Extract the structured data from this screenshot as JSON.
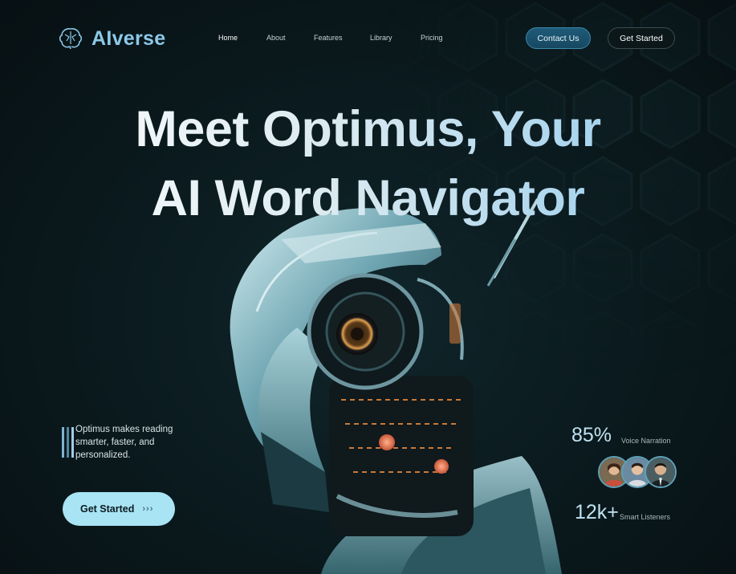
{
  "brand": {
    "name": "AIverse",
    "logo_icon": "brain-icon"
  },
  "nav": {
    "items": [
      {
        "label": "Home",
        "active": true
      },
      {
        "label": "About",
        "active": false
      },
      {
        "label": "Features",
        "active": false
      },
      {
        "label": "Library",
        "active": false
      },
      {
        "label": "Pricing",
        "active": false
      }
    ],
    "contact_label": "Contact Us",
    "get_started_label": "Get Started"
  },
  "hero": {
    "title_line1": "Meet Optimus, Your",
    "title_line2": "AI Word Navigator",
    "description": "Optimus makes reading smarter, faster, and personalized.",
    "cta_label": "Get Started",
    "cta_icon": "triple-chevron-right-icon"
  },
  "stats": [
    {
      "value": "85%",
      "label": "Voice Narration"
    },
    {
      "value": "12k+",
      "label": "Smart Listeners"
    }
  ],
  "colors": {
    "background": "#0b1b1f",
    "accent": "#8cc8e8",
    "cta_background": "#a8e4f4",
    "contact_button": "#1f5a78"
  }
}
